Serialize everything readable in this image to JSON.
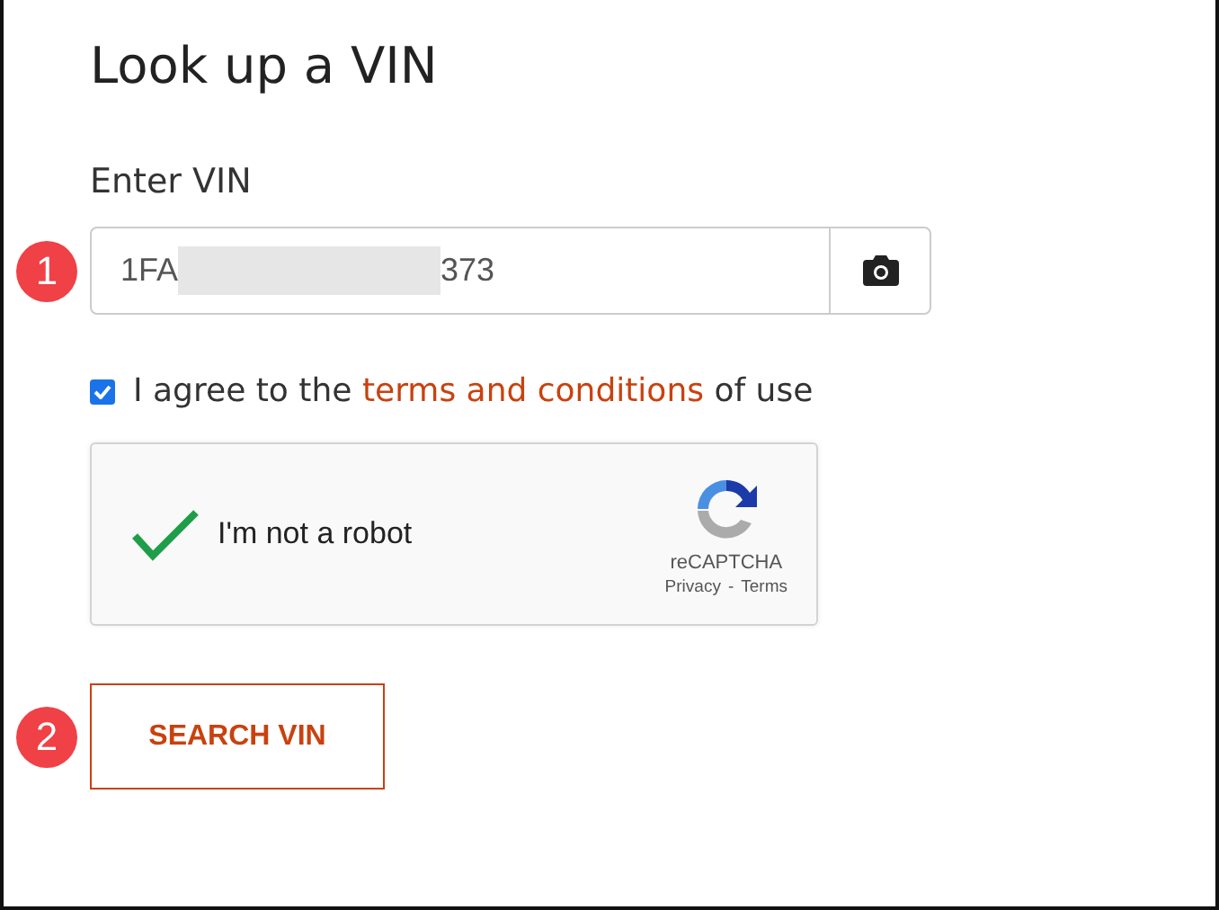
{
  "heading": "Look up a VIN",
  "vin_field": {
    "label": "Enter VIN",
    "value_start": "1FA",
    "value_end": "373",
    "redacted": true,
    "callout": "1"
  },
  "agreement": {
    "checked": true,
    "text_before": "I agree to the",
    "link": "terms and conditions",
    "text_after": "of use"
  },
  "captcha": {
    "checked": true,
    "label": "I'm not a robot",
    "brand": "reCAPTCHA",
    "privacy": "Privacy",
    "separator": "-",
    "terms": "Terms"
  },
  "search_button": {
    "label": "SEARCH VIN",
    "callout": "2"
  }
}
